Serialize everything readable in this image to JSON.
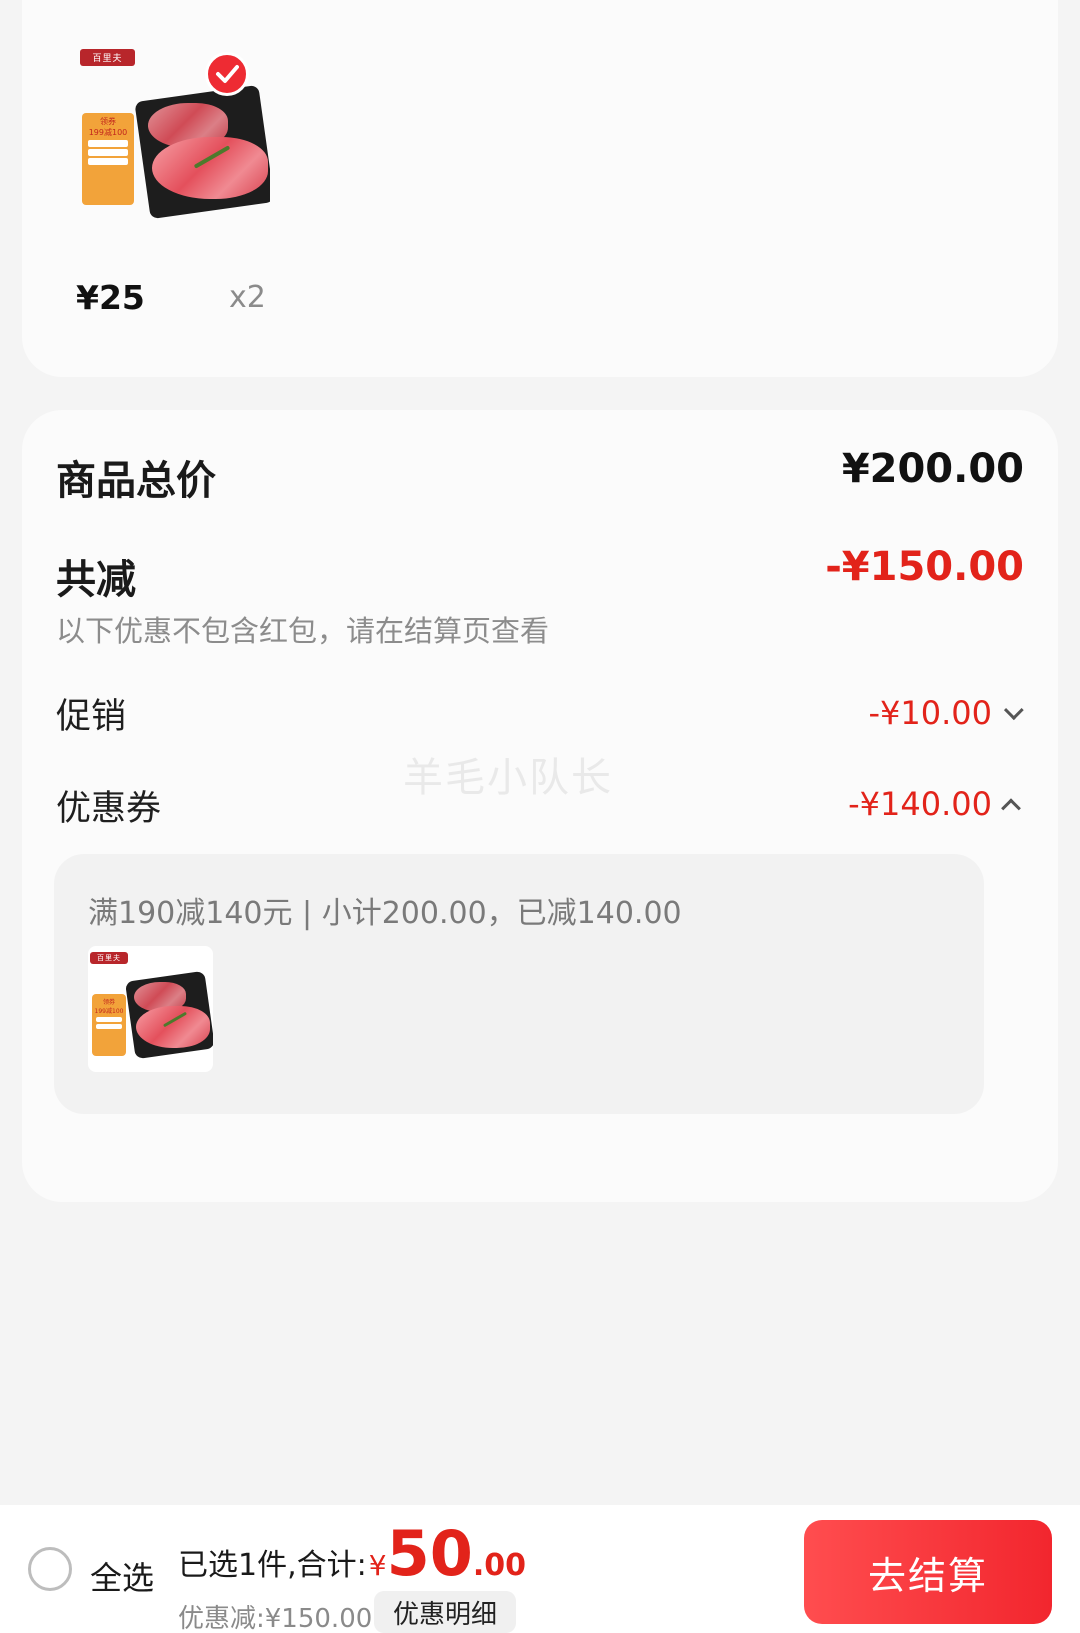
{
  "cart_item": {
    "price": "¥25",
    "quantity": "x2",
    "image_icon": "beef-slices-product-image",
    "selected_icon": "check-icon"
  },
  "summary": {
    "total_label": "商品总价",
    "total_value": "¥200.00",
    "reduce_label": "共减",
    "reduce_value": "-¥150.00",
    "note": "以下优惠不包含红包，请在结算页查看",
    "promo_label": "促销",
    "promo_value": "-¥10.00",
    "coupon_label": "优惠券",
    "coupon_value": "-¥140.00",
    "coupon_detail": "满190减140元 | 小计200.00，已减140.00"
  },
  "watermark": "羊毛小队长",
  "bottom_bar": {
    "select_all": "全选",
    "selected_text": "已选1件,合计:",
    "currency": "¥",
    "amount_int": "50",
    "amount_dec": ".00",
    "discount_text": "优惠减:¥150.00",
    "detail_button": "优惠明细",
    "checkout_button": "去结算"
  },
  "colors": {
    "accent_red": "#e2231a",
    "checkout_gradient_start": "#ff4d4f",
    "checkout_gradient_end": "#f2262e"
  }
}
